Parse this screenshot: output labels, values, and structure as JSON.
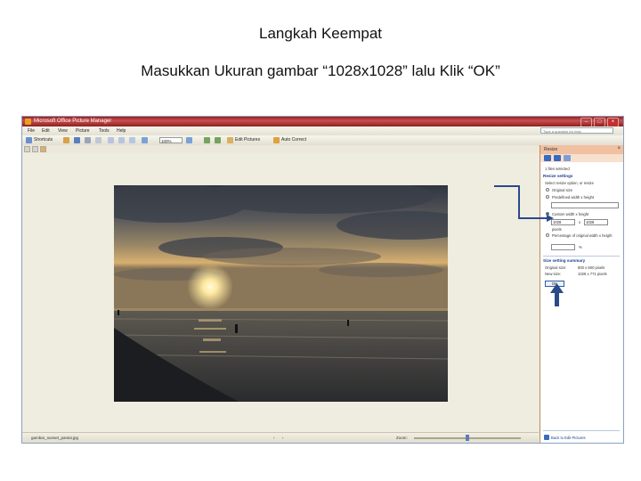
{
  "slide": {
    "title": "Langkah Keempat",
    "subtitle": "Masukkan Ukuran gambar “1028x1028” lalu Klik “OK”"
  },
  "app": {
    "title": "Microsoft Office Picture Manager",
    "controls": [
      "–",
      "□",
      "×"
    ],
    "accent": "#a82828"
  },
  "menu": {
    "items": [
      "File",
      "Edit",
      "View",
      "Picture",
      "Tools",
      "Help"
    ],
    "help_placeholder": "Type a question for help"
  },
  "toolbar": {
    "shortcuts_label": "Shortcuts",
    "zoom_value": "100%",
    "edit_pictures_label": "Edit Pictures",
    "auto_correct_label": "Auto Correct"
  },
  "task_pane": {
    "title": "Resize",
    "selected_text": "1 files selected",
    "resize_settings_header": "Resize settings",
    "resize_settings_desc": "Select resize option, or resize",
    "original_size_label": "Original size",
    "predefined_label": "Predefined width x height",
    "custom_label": "Custom width x height",
    "width_value": "1028",
    "x_label": "x",
    "height_value": "1028",
    "pixels_label": "pixels",
    "percentage_label": "Percentage of original width x height",
    "percent_sign": "%",
    "summary_header": "Size setting summary",
    "original_size_summary_label": "Original size:",
    "original_size_summary_value": "800 x 600 pixels",
    "new_size_summary_label": "New size:",
    "new_size_summary_value": "1028 x 771 pixels",
    "ok_label": "OK",
    "back_link": "Back to Edit Pictures"
  },
  "status": {
    "filename": "gambar_sunset_pantai.jpg",
    "zoom_label": "Zoom:"
  }
}
